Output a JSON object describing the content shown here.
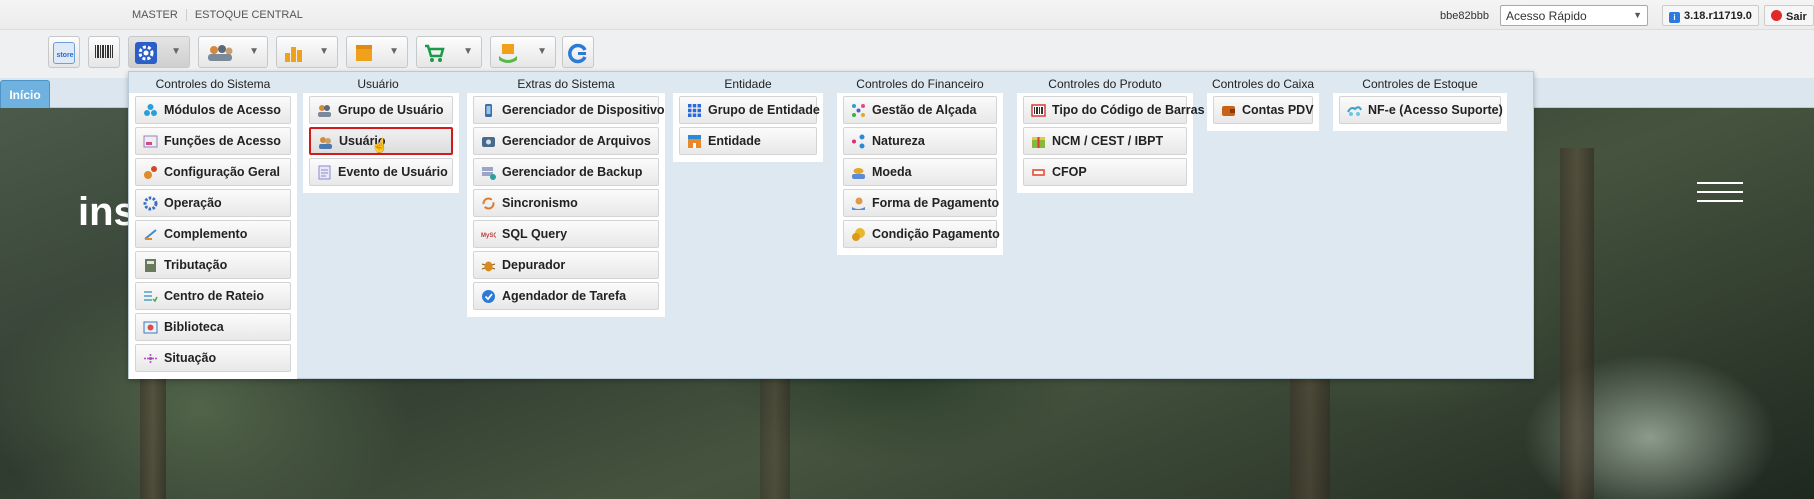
{
  "header": {
    "breadcrumb": [
      "MASTER",
      "ESTOQUE CENTRAL"
    ],
    "session_hash": "bbe82bbb",
    "quick_access_value": "Acesso Rápido",
    "version": "3.18.r11719.0",
    "logout_label": "Sair"
  },
  "toolbar": {
    "buttons": [
      {
        "name": "store",
        "icon": "store-icon",
        "has_dropdown": false
      },
      {
        "name": "boleto",
        "icon": "barcode-icon",
        "has_dropdown": false
      },
      {
        "name": "settings",
        "icon": "gear-icon",
        "has_dropdown": true,
        "active": true
      },
      {
        "name": "users",
        "icon": "users-icon",
        "has_dropdown": true
      },
      {
        "name": "reports",
        "icon": "bar-chart-icon",
        "has_dropdown": true
      },
      {
        "name": "box",
        "icon": "box-icon",
        "has_dropdown": true
      },
      {
        "name": "cart",
        "icon": "cart-icon",
        "has_dropdown": true
      },
      {
        "name": "product",
        "icon": "hand-box-icon",
        "has_dropdown": true
      },
      {
        "name": "sync",
        "icon": "refresh-g-icon",
        "has_dropdown": false
      }
    ]
  },
  "tabs": [
    {
      "label": "Início"
    }
  ],
  "hero": {
    "text": "ins"
  },
  "menu": {
    "columns": [
      {
        "title": "Controles do Sistema",
        "items": [
          {
            "label": "Módulos de Acesso",
            "icon": "modules-icon",
            "color": "#2aa0d8"
          },
          {
            "label": "Funções de Acesso",
            "icon": "functions-icon",
            "color": "#9a7ec4"
          },
          {
            "label": "Configuração Geral",
            "icon": "config-icon",
            "color": "#e08a2a"
          },
          {
            "label": "Operação",
            "icon": "operation-gear-icon",
            "color": "#3b6fc2"
          },
          {
            "label": "Complemento",
            "icon": "complement-icon",
            "color": "#3c8bd6"
          },
          {
            "label": "Tributação",
            "icon": "calculator-icon",
            "color": "#6b7a5e"
          },
          {
            "label": "Centro de Rateio",
            "icon": "checklist-icon",
            "color": "#4aa0c8"
          },
          {
            "label": "Biblioteca",
            "icon": "library-icon",
            "color": "#e04a4a"
          },
          {
            "label": "Situação",
            "icon": "status-dots-icon",
            "color": "#b04ac0"
          }
        ]
      },
      {
        "title": "Usuário",
        "items": [
          {
            "label": "Grupo de Usuário",
            "icon": "user-group-icon",
            "color": "#d48a3a"
          },
          {
            "label": "Usuário",
            "icon": "user-icon",
            "color": "#d48a3a",
            "highlighted": true
          },
          {
            "label": "Evento de Usuário",
            "icon": "user-event-icon",
            "color": "#8a8ad0"
          }
        ]
      },
      {
        "title": "Extras do Sistema",
        "items": [
          {
            "label": "Gerenciador de Dispositivo",
            "icon": "device-icon",
            "color": "#3b6fa8"
          },
          {
            "label": "Gerenciador de Arquivos",
            "icon": "file-manager-icon",
            "color": "#4a6a8a"
          },
          {
            "label": "Gerenciador de Backup",
            "icon": "backup-icon",
            "color": "#9aa6c8"
          },
          {
            "label": "Sincronismo",
            "icon": "sync-icon",
            "color": "#e07a2a"
          },
          {
            "label": "SQL Query",
            "icon": "sql-icon",
            "color": "#c03a3a"
          },
          {
            "label": "Depurador",
            "icon": "bug-icon",
            "color": "#d88a1a"
          },
          {
            "label": "Agendador de Tarefa",
            "icon": "task-scheduler-icon",
            "color": "#2a7ad8"
          }
        ]
      },
      {
        "title": "Entidade",
        "items": [
          {
            "label": "Grupo de Entidade",
            "icon": "entity-group-icon",
            "color": "#2a6ad8"
          },
          {
            "label": "Entidade",
            "icon": "entity-icon",
            "color": "#e8882a"
          }
        ]
      },
      {
        "title": "Controles do Financeiro",
        "items": [
          {
            "label": "Gestão de Alçada",
            "icon": "approval-icon",
            "color": "#2aa0d8"
          },
          {
            "label": "Natureza",
            "icon": "nature-icon",
            "color": "#e02a7a"
          },
          {
            "label": "Moeda",
            "icon": "coin-icon",
            "color": "#e0a82a"
          },
          {
            "label": "Forma de Pagamento",
            "icon": "payment-icon",
            "color": "#e09a4a"
          },
          {
            "label": "Condição Pagamento",
            "icon": "payment-condition-icon",
            "color": "#e8b82a"
          }
        ]
      },
      {
        "title": "Controles do Produto",
        "items": [
          {
            "label": "Tipo do Código de Barras",
            "icon": "barcode-type-icon",
            "color": "#d83a3a"
          },
          {
            "label": "NCM / CEST / IBPT",
            "icon": "ncm-icon",
            "color": "#8ab83a"
          },
          {
            "label": "CFOP",
            "icon": "cfop-icon",
            "color": "#e86a5a"
          }
        ]
      },
      {
        "title": "Controles do Caixa",
        "items": [
          {
            "label": "Contas PDV",
            "icon": "wallet-icon",
            "color": "#c8641a"
          }
        ]
      },
      {
        "title": "Controles de Estoque",
        "items": [
          {
            "label": "NF-e (Acesso Suporte)",
            "icon": "nfe-icon",
            "color": "#3aa0c8"
          }
        ]
      }
    ]
  }
}
